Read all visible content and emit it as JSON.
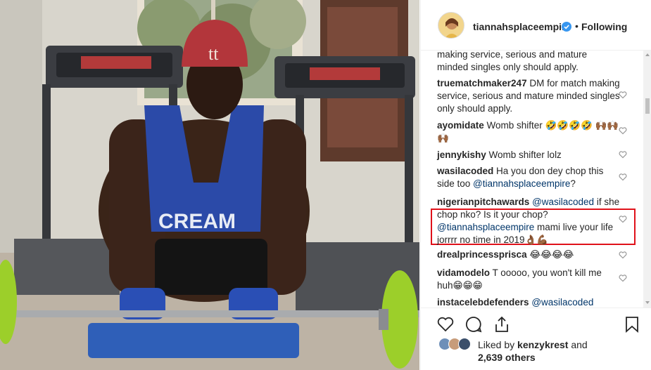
{
  "photo": {
    "description_icon": "gym-photo",
    "cap_logo": "tt",
    "shirt_text": "CREAM"
  },
  "header": {
    "username": "tiannahsplaceempire",
    "separator": "•",
    "follow_label": "Following"
  },
  "comments": [
    {
      "user": "",
      "text": "making service, serious and mature minded singles only should apply."
    },
    {
      "user": "truematchmaker247",
      "text": " DM for match making service, serious and mature minded singles only should apply."
    },
    {
      "user": "ayomidate",
      "text": " Womb shifter 🤣🤣🤣🤣 🙌🏾🙌🏾🙌🏾"
    },
    {
      "user": "jennykishy",
      "text": " Womb shifter lolz"
    },
    {
      "user": "wasilacoded",
      "text": " Ha you don dey chop this side too ",
      "mention": "@tiannahsplaceempire",
      "tail": "?"
    },
    {
      "user": "nigerianpitchawards",
      "text": " ",
      "mention": "@wasilacoded",
      "tail": " if she chop nko? Is it your chop? ",
      "mention2": "@tiannahsplaceempire",
      "tail2": " mami live your life jorrrr no time in 2019👌🏾💪🏾"
    },
    {
      "user": "drealprincessprisca",
      "text": " 😂😂😂😂"
    },
    {
      "user": "vidamodelo",
      "text": " T ooooo, you won't kill me huh😁😁😁"
    },
    {
      "user": "instacelebdefenders",
      "text": " ",
      "mention": "@wasilacoded",
      "tail": ""
    }
  ],
  "likes": {
    "prefix": "Liked by ",
    "user": "kenzykrest",
    "middle": " and",
    "count": "2,639 others"
  },
  "colors": {
    "highlight_border": "#e0111a",
    "mention": "#003569",
    "verified_badge": "#3897f0"
  }
}
